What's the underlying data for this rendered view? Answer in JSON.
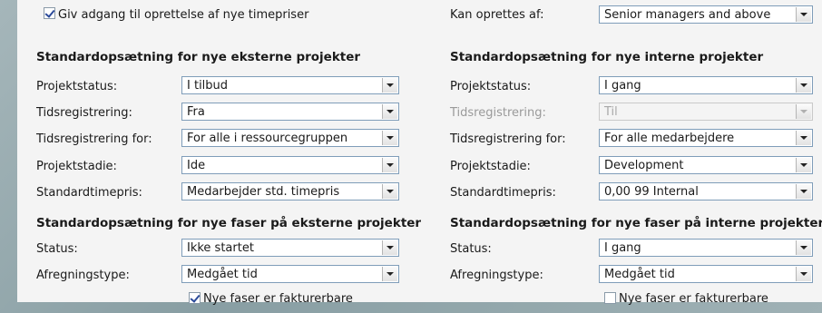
{
  "top": {
    "checkbox_label": "Giv adgang til oprettelse af nye timepriser",
    "checkbox_checked": true,
    "created_by_label": "Kan oprettes af:",
    "created_by_value": "Senior managers and above"
  },
  "external": {
    "heading": "Standardopsætning for nye eksterne projekter",
    "fields": [
      {
        "label": "Projektstatus:",
        "value": "I tilbud"
      },
      {
        "label": "Tidsregistrering:",
        "value": "Fra"
      },
      {
        "label": "Tidsregistrering for:",
        "value": "For alle i ressourcegruppen"
      },
      {
        "label": "Projektstadie:",
        "value": "Ide"
      },
      {
        "label": "Standardtimepris:",
        "value": "Medarbejder std. timepris"
      }
    ]
  },
  "internal": {
    "heading": "Standardopsætning for nye interne projekter",
    "fields": [
      {
        "label": "Projektstatus:",
        "value": "I gang"
      },
      {
        "label": "Tidsregistrering:",
        "value": "Til",
        "disabled": true
      },
      {
        "label": "Tidsregistrering for:",
        "value": "For alle medarbejdere"
      },
      {
        "label": "Projektstadie:",
        "value": "Development"
      },
      {
        "label": "Standardtimepris:",
        "value": "0,00 99 Internal"
      }
    ]
  },
  "external_phases": {
    "heading": "Standardopsætning for nye faser på eksterne projekter",
    "fields": [
      {
        "label": "Status:",
        "value": "Ikke startet"
      },
      {
        "label": "Afregningstype:",
        "value": "Medgået tid"
      }
    ],
    "billable_label": "Nye faser er fakturerbare",
    "billable_checked": true
  },
  "internal_phases": {
    "heading": "Standardopsætning for nye faser på interne projekter",
    "fields": [
      {
        "label": "Status:",
        "value": "I gang"
      },
      {
        "label": "Afregningstype:",
        "value": "Medgået tid"
      }
    ],
    "billable_label": "Nye faser er fakturerbare",
    "billable_checked": false
  }
}
